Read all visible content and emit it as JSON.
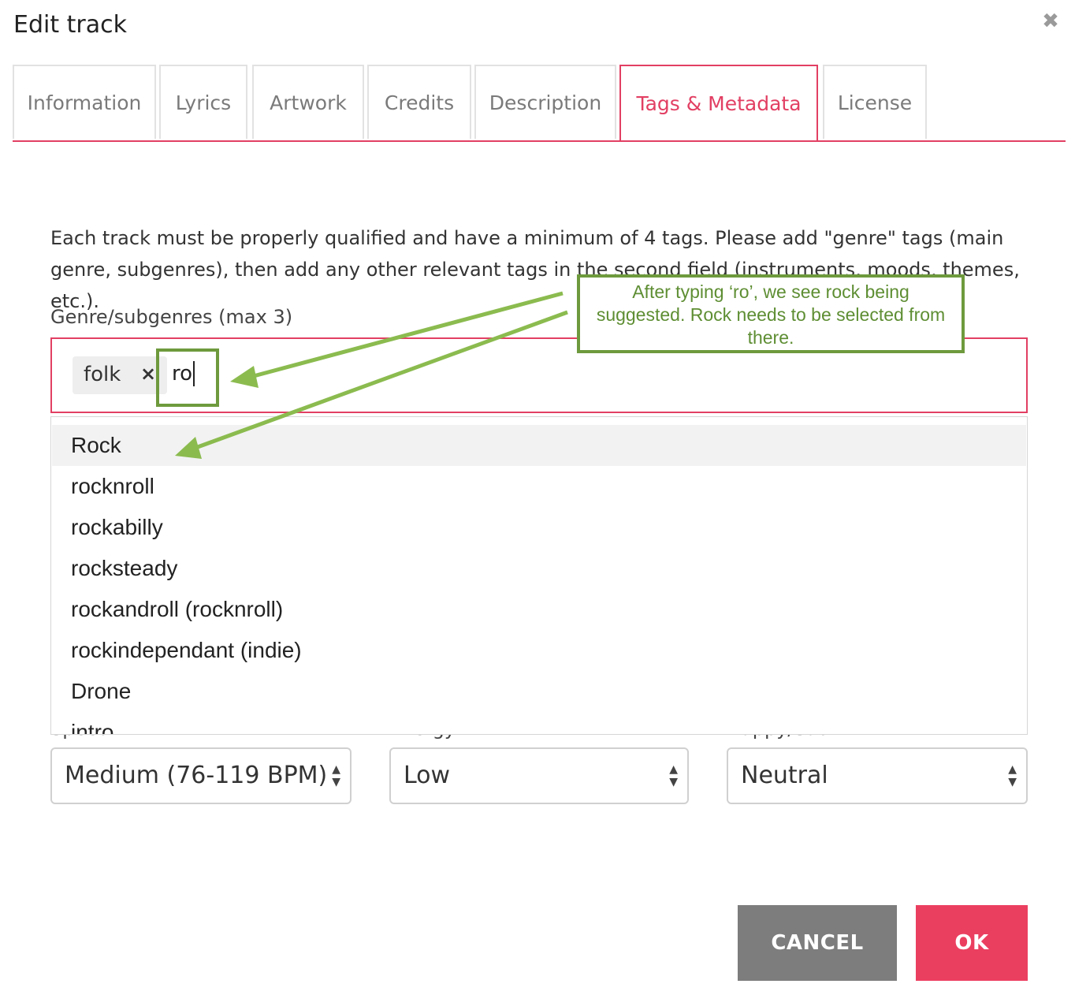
{
  "dialog": {
    "title": "Edit track",
    "close_icon": "close-icon",
    "close_glyph": "✖"
  },
  "tabs": [
    {
      "label": "Information",
      "active": false
    },
    {
      "label": "Lyrics",
      "active": false
    },
    {
      "label": "Artwork",
      "active": false
    },
    {
      "label": "Credits",
      "active": false
    },
    {
      "label": "Description",
      "active": false
    },
    {
      "label": "Tags & Metadata",
      "active": true
    },
    {
      "label": "License",
      "active": false
    }
  ],
  "intro_text": "Each track must be properly qualified and have a minimum of 4 tags. Please add \"genre\" tags (main genre, subgenres), then add any other relevant tags in the second field (instruments, moods, themes, etc.).",
  "genre_field": {
    "label": "Genre/subgenres (max 3)",
    "tags": [
      {
        "label": "folk",
        "remove_glyph": "×"
      }
    ],
    "typed_value": "ro"
  },
  "suggestions": [
    {
      "label": "Rock",
      "highlighted": true
    },
    {
      "label": "rocknroll",
      "highlighted": false
    },
    {
      "label": "rockabilly",
      "highlighted": false
    },
    {
      "label": "rocksteady",
      "highlighted": false
    },
    {
      "label": "rockandroll (rocknroll)",
      "highlighted": false
    },
    {
      "label": "rockindependant (indie)",
      "highlighted": false
    },
    {
      "label": "Drone",
      "highlighted": false
    },
    {
      "label": "intro",
      "highlighted": false
    }
  ],
  "selects": [
    {
      "label": "Speed",
      "value": "Medium (76-119 BPM)"
    },
    {
      "label": "Energy",
      "value": "Low"
    },
    {
      "label": "Happy/Sad",
      "value": "Neutral"
    }
  ],
  "select_arrow_up": "▲",
  "select_arrow_down": "▼",
  "buttons": {
    "cancel": "CANCEL",
    "ok": "OK"
  },
  "annotation": {
    "text": "After typing ‘ro’, we see rock being suggested. Rock needs to be selected from there.",
    "color": "#6e9a3d",
    "arrow_color": "#8bbb4f"
  },
  "colors": {
    "accent": "#e23f63",
    "ok_button": "#eb3f60",
    "cancel_button": "#7d7d7d"
  }
}
